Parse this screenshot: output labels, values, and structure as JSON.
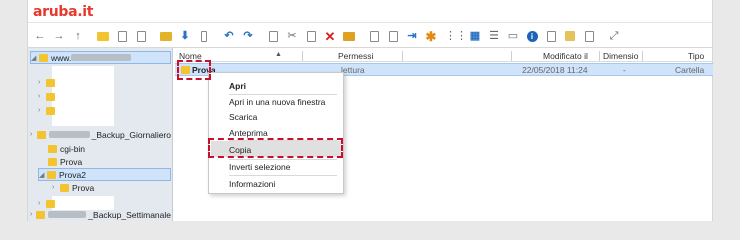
{
  "brand": {
    "logo": "aruba.it"
  },
  "toolbar": {
    "icons": [
      "back-icon",
      "forward-icon",
      "up-icon",
      "new-folder-icon",
      "new-file-icon",
      "open-icon",
      "upload-icon",
      "download-icon",
      "mobile-icon",
      "undo-icon",
      "redo-icon",
      "copy-icon",
      "cut-icon",
      "paste-icon",
      "delete-icon",
      "archive-icon",
      "duplicate-icon",
      "rename-icon",
      "extract-icon",
      "star-icon",
      "select-icon",
      "view-icons-icon",
      "view-list-icon",
      "preview-icon",
      "info-icon",
      "edit-icon",
      "image-icon",
      "resize-icon",
      "fullscreen-icon"
    ]
  },
  "tree": {
    "root_label": "www.",
    "backup_daily": "_Backup_Giornaliero",
    "items": [
      {
        "label": "cgi-bin"
      },
      {
        "label": "Prova"
      },
      {
        "label": "Prova2"
      },
      {
        "label": "Prova"
      }
    ],
    "backup_weekly": "_Backup_Settimanale"
  },
  "list": {
    "columns": {
      "name": "Nome",
      "permissions": "Permessi",
      "modified": "Modificato il",
      "size": "Dimensio",
      "type": "Tipo"
    },
    "row": {
      "name": "Prova",
      "permissions": "lettura",
      "modified": "22/05/2018 11:24",
      "size": "-",
      "type": "Cartella"
    }
  },
  "context_menu": {
    "items": [
      {
        "label": "Apri",
        "bold": true
      },
      {
        "label": "Apri in una nuova finestra"
      },
      {
        "label": "Scarica"
      },
      {
        "label": "Anteprima"
      },
      {
        "label": "Copia",
        "highlighted": true
      },
      {
        "label": "Inverti selezione"
      },
      {
        "label": "Informazioni"
      }
    ]
  },
  "colors": {
    "brand": "#e8382e",
    "highlight": "#c8102e",
    "selection": "#cfe3fa"
  }
}
